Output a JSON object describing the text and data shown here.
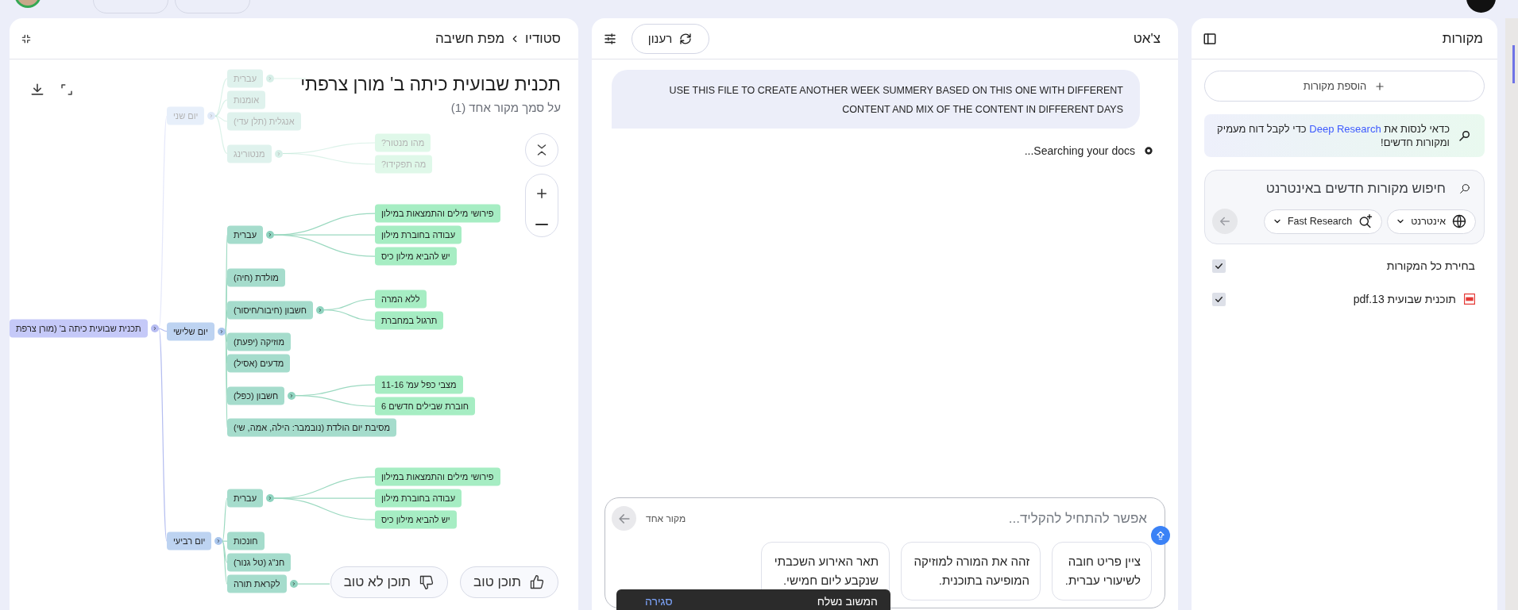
{
  "studio": {
    "breadcrumb": [
      "סטודיו",
      "מפת חשיבה"
    ],
    "title": "תכנית שבועית כיתה ב' מורן צרפתי",
    "subtitle": "על סמך מקור אחד (1)",
    "mind_map": {
      "label": "תכנית שבועית כיתה ב' (מורן צרפת",
      "faded": false,
      "expanded": true,
      "children": [
        {
          "label": "יום שני",
          "faded": true,
          "expanded": true,
          "children": [
            {
              "label": "עברית",
              "faded": true,
              "expanded": true
            },
            {
              "label": "אומנות",
              "faded": true,
              "expanded": false
            },
            {
              "label": "אנגלית (תלן עדי)",
              "faded": true,
              "expanded": false
            },
            {
              "label": "מנטורינג",
              "faded": true,
              "expanded": true,
              "children": [
                {
                  "label": "מהו מנטור?",
                  "faded": true,
                  "expanded": false
                },
                {
                  "label": "מה תפקידו?",
                  "faded": true,
                  "expanded": false
                }
              ]
            }
          ]
        },
        {
          "label": "יום שלישי",
          "faded": false,
          "expanded": true,
          "children": [
            {
              "label": "עברית",
              "faded": false,
              "expanded": true,
              "children": [
                {
                  "label": "פירושי מילים והתמצאות במילון",
                  "faded": false,
                  "expanded": false
                },
                {
                  "label": "עבודה בחוברת מילון",
                  "faded": false,
                  "expanded": false
                },
                {
                  "label": "יש להביא מילון כיס",
                  "faded": false,
                  "expanded": false
                }
              ]
            },
            {
              "label": "מולדת (חיה)",
              "faded": false,
              "expanded": false
            },
            {
              "label": "חשבון (חיבור/חיסור)",
              "faded": false,
              "expanded": true,
              "children": [
                {
                  "label": "ללא המרה",
                  "faded": false,
                  "expanded": false
                },
                {
                  "label": "תרגול במחברת",
                  "faded": false,
                  "expanded": false
                }
              ]
            },
            {
              "label": "מוזיקה (יפעת)",
              "faded": false,
              "expanded": false
            },
            {
              "label": "מדעים (אסיל)",
              "faded": false,
              "expanded": false
            },
            {
              "label": "חשבון (כפל)",
              "faded": false,
              "expanded": true,
              "children": [
                {
                  "label": "מצבי כפל עמ' 11-16",
                  "faded": false,
                  "expanded": false
                },
                {
                  "label": "חוברת שבילים חדשים 6",
                  "faded": false,
                  "expanded": false
                }
              ]
            },
            {
              "label": "מסיבת יום הולדת (נובמבר: הילה, אמה, שי)",
              "faded": false,
              "expanded": false
            }
          ]
        },
        {
          "label": "יום רביעי",
          "faded": false,
          "expanded": true,
          "children": [
            {
              "label": "עברית",
              "faded": false,
              "expanded": true,
              "children": [
                {
                  "label": "פירושי מילים והתמצאות במילון",
                  "faded": false,
                  "expanded": false
                },
                {
                  "label": "עבודה בחוברת מילון",
                  "faded": false,
                  "expanded": false
                },
                {
                  "label": "יש להביא מילון כיס",
                  "faded": false,
                  "expanded": false
                }
              ]
            },
            {
              "label": "חונכות",
              "faded": false,
              "expanded": false
            },
            {
              "label": "חנ\"ג (טל גנור)",
              "faded": false,
              "expanded": false
            },
            {
              "label": "לקראת תורה",
              "faded": false,
              "expanded": true
            }
          ]
        }
      ]
    },
    "feedback_buttons": [
      {
        "kind": "good",
        "label": "תוכן טוב"
      },
      {
        "kind": "bad",
        "label": "תוכן לא טוב"
      }
    ]
  },
  "chat": {
    "title": "צ'אט",
    "refresh_label": "רענון",
    "messages": [
      {
        "kind": "user",
        "text": "USE THIS FILE TO CREATE ANOTHER WEEK SUMMERY BASED ON THIS ONE WITH DIFFERENT CONTENT AND MIX OF THE CONTENT IN DIFFERENT DAYS"
      },
      {
        "kind": "status",
        "text": "Searching your docs..."
      }
    ],
    "input": {
      "placeholder": "אפשר להתחיל להקליד...",
      "source_count": "מקור אחד"
    },
    "suggestions": [
      "ציין פריט חובה לשיעורי עברית.",
      "זהה את המורה למוזיקה המופיעה בתוכנית.",
      "תאר האירוע השכבתי שנקבע ליום חמישי."
    ],
    "toast": {
      "text": "המשוב נשלח",
      "action": "סגירה"
    }
  },
  "sources": {
    "title": "מקורות",
    "add_label": "הוספת מקורות",
    "promo": {
      "before": "כדאי לנסות את ",
      "link": "Deep Research",
      "after": " כדי לקבל דוח מעמיק ומקורות חדשים!"
    },
    "search": {
      "placeholder": "חיפוש מקורות חדשים באינטרנט",
      "chips": [
        {
          "kind": "web",
          "label": "אינטרנט"
        },
        {
          "kind": "research",
          "label": "Fast Research"
        }
      ]
    },
    "select_all": {
      "label": "בחירת כל המקורות",
      "checked": true
    },
    "items": [
      {
        "kind": "pdf",
        "label": "תוכנית שבועית 13.pdf",
        "checked": true
      }
    ]
  }
}
